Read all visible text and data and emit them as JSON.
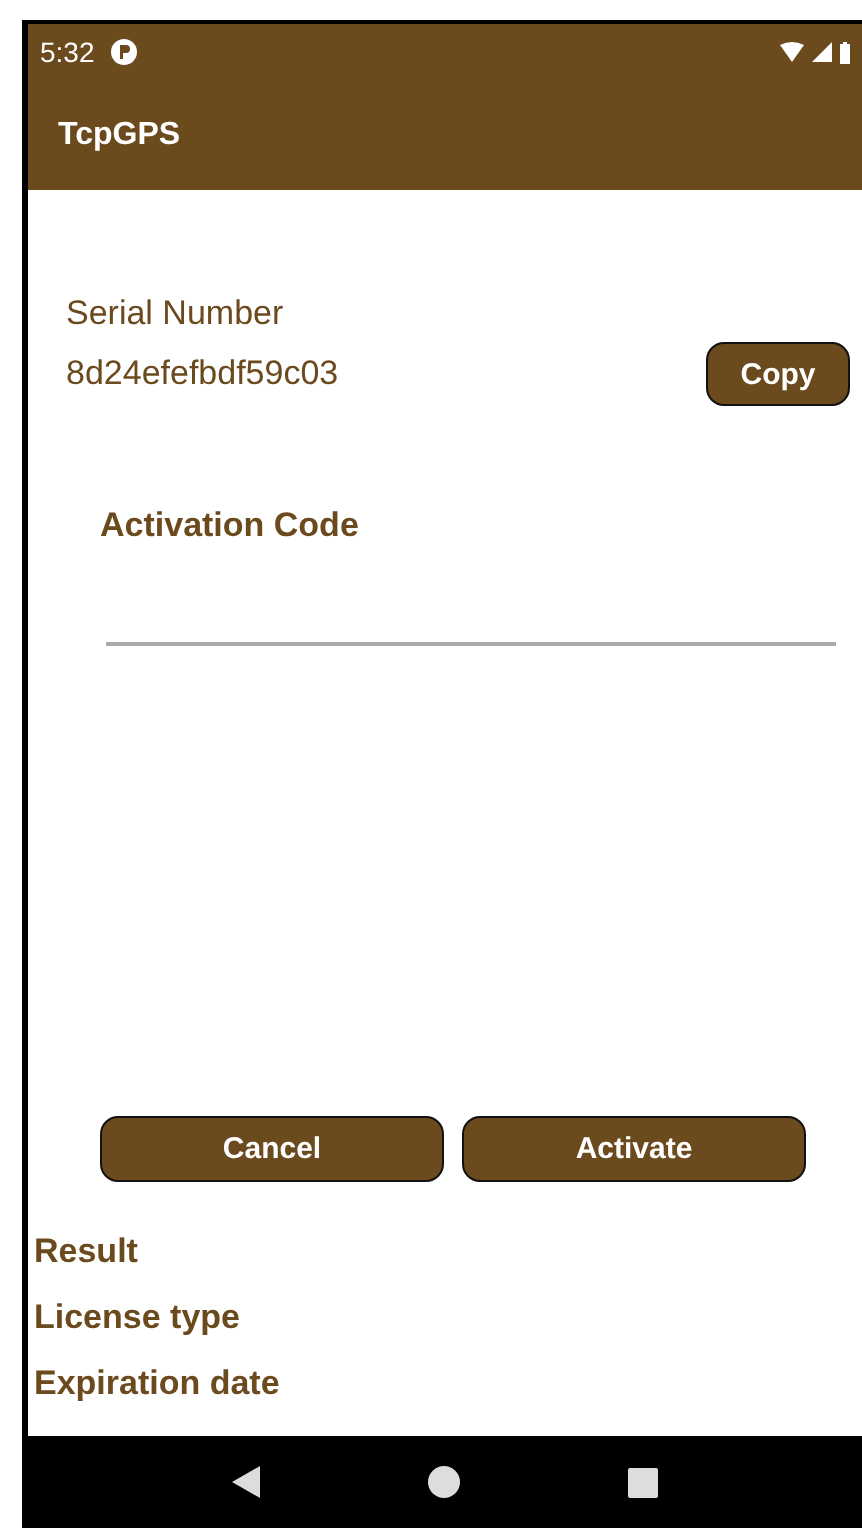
{
  "status_bar": {
    "time": "5:32"
  },
  "app_bar": {
    "title": "TcpGPS"
  },
  "serial": {
    "label": "Serial Number",
    "value": "8d24efefbdf59c03",
    "copy_button": "Copy"
  },
  "activation": {
    "label": "Activation Code"
  },
  "buttons": [
    {
      "label": "Cancel"
    },
    {
      "label": "Activate"
    }
  ],
  "info": [
    "Result",
    "License type",
    "Expiration date"
  ]
}
